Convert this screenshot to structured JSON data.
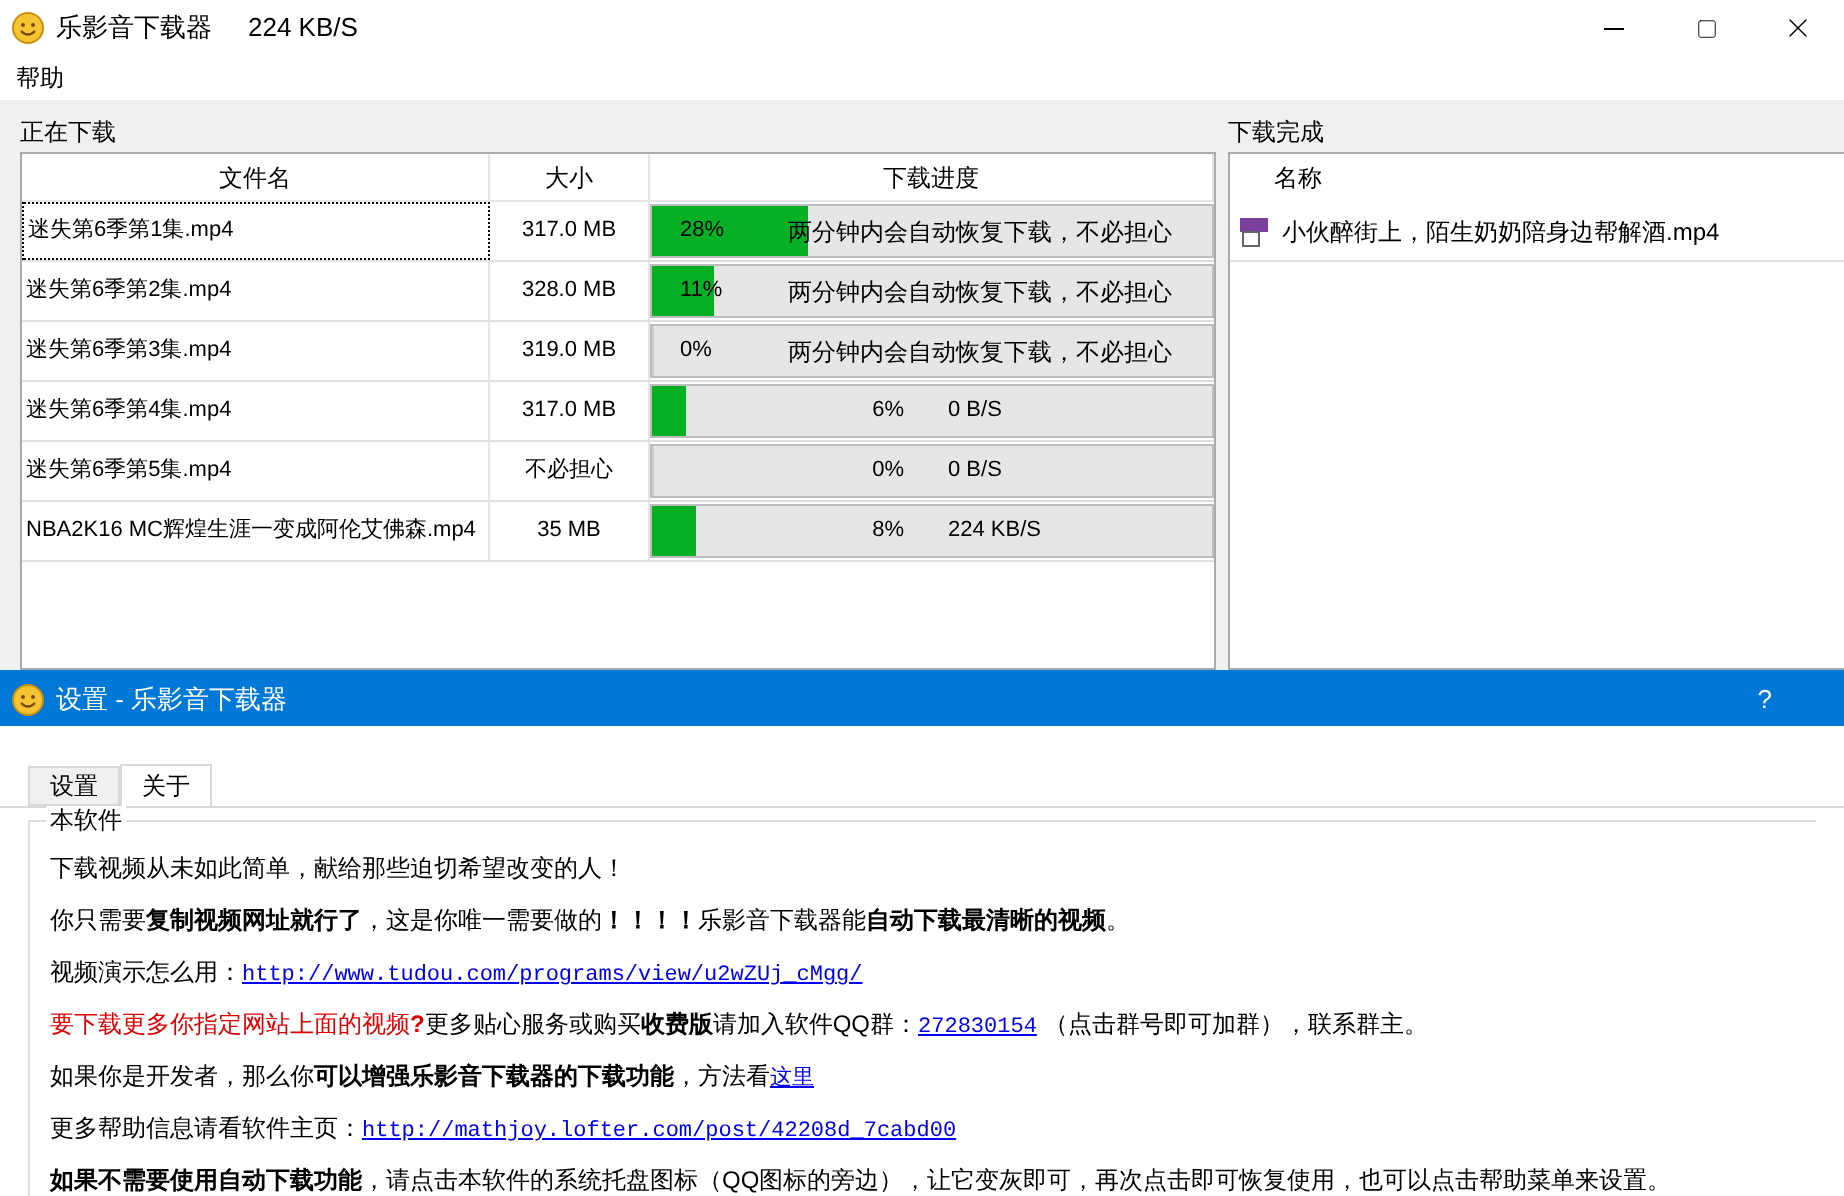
{
  "window": {
    "title": "乐影音下载器",
    "speed": "224 KB/S"
  },
  "menu": [
    {
      "label": "帮助"
    }
  ],
  "downloading": {
    "title": "正在下载",
    "columns": [
      "文件名",
      "大小",
      "下载进度"
    ],
    "rows": [
      {
        "name": "迷失第6季第1集.mp4",
        "size": "317.0 MB",
        "level": 0.28,
        "percent": "28%",
        "kind": "message",
        "status": "两分钟内会自动恢复下载，不必担心",
        "selected": true
      },
      {
        "name": "迷失第6季第2集.mp4",
        "size": "328.0 MB",
        "level": 0.11,
        "percent": "11%",
        "kind": "message",
        "status": "两分钟内会自动恢复下载，不必担心",
        "selected": false
      },
      {
        "name": "迷失第6季第3集.mp4",
        "size": "319.0 MB",
        "level": 0,
        "percent": "0%",
        "kind": "message",
        "status": "两分钟内会自动恢复下载，不必担心",
        "selected": false
      },
      {
        "name": "迷失第6季第4集.mp4",
        "size": "317.0 MB",
        "level": 0.06,
        "percent": "6%",
        "kind": "speed",
        "status": "0 B/S",
        "selected": false
      },
      {
        "name": "迷失第6季第5集.mp4",
        "size": "不必担心",
        "level": 0,
        "percent": "0%",
        "kind": "speed",
        "status": "0 B/S",
        "selected": false
      },
      {
        "name": "NBA2K16 MC辉煌生涯一变成阿伦艾佛森.mp4",
        "size": "35 MB",
        "level": 0.08,
        "percent": "8%",
        "kind": "speed",
        "status": "224 KB/S",
        "selected": false
      }
    ]
  },
  "completed": {
    "title": "下载完成",
    "columns": [
      "名称"
    ],
    "rows": [
      {
        "name": "小伙醉街上，陌生奶奶陪身边帮解酒.mp4"
      }
    ]
  },
  "dialog": {
    "title": "设置 - 乐影音下载器",
    "help": "?",
    "tabs": [
      {
        "label": "设置",
        "selected": false
      },
      {
        "label": "关于",
        "selected": true
      }
    ],
    "group": "本软件",
    "lines": [
      [
        {
          "kind": "text",
          "text": "下载视频从未如此简单，献给那些迫切希望改变的人！"
        }
      ],
      [
        {
          "kind": "text",
          "text": "你只需要**复制视频网址就行了**，这是你唯一需要做的**！！！！**乐影音下载器能**自动下载最清晰的视频**。"
        }
      ],
      [
        {
          "kind": "text",
          "text": "视频演示怎么用："
        },
        {
          "kind": "link",
          "text": "http://www.tudou.com/programs/view/u2wZUj_cMgg/"
        }
      ],
      [
        {
          "kind": "warning",
          "text": "要下载更多你指定网站上面的视频**?**"
        },
        {
          "kind": "text",
          "text": "更多贴心服务或购买**收费版**请加入软件QQ群："
        },
        {
          "kind": "link",
          "text": "272830154"
        },
        {
          "kind": "text",
          "text": " （点击群号即可加群），联系群主。"
        }
      ],
      [
        {
          "kind": "text",
          "text": "如果你是开发者，那么你**可以增强乐影音下载器的下载功能**，方法看"
        },
        {
          "kind": "link",
          "text": "这里"
        }
      ],
      [
        {
          "kind": "text",
          "text": "更多帮助信息请看软件主页："
        },
        {
          "kind": "link",
          "text": "http://mathjoy.lofter.com/post/42208d_7cabd00"
        }
      ],
      [
        {
          "kind": "text",
          "text": "**如果不需要使用自动下载功能**，请点击本软件的系统托盘图标（QQ图标的旁边），让它变灰即可，再次点击即可恢复使用，也可以点击帮助菜单来设置。"
        }
      ]
    ]
  }
}
